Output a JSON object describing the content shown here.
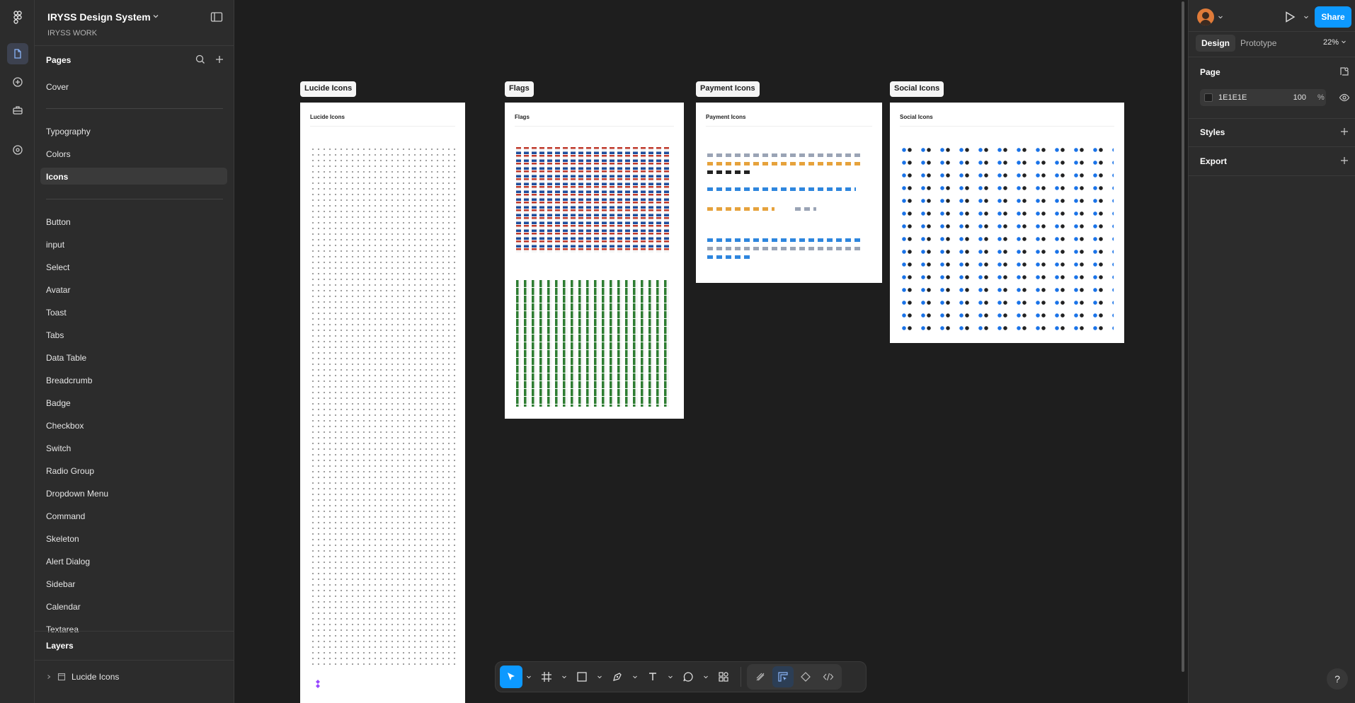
{
  "file": {
    "title": "IRYSS Design System",
    "team": "IRYSS WORK"
  },
  "pages": {
    "heading": "Pages",
    "group1": [
      "Cover"
    ],
    "group2": [
      "Typography",
      "Colors",
      "Icons"
    ],
    "group3": [
      "Button",
      "input",
      "Select",
      "Avatar",
      "Toast",
      "Tabs",
      "Data Table",
      "Breadcrumb",
      "Badge",
      "Checkbox",
      "Switch",
      "Radio Group",
      "Dropdown Menu",
      "Command",
      "Skeleton",
      "Alert Dialog",
      "Sidebar",
      "Calendar",
      "Textarea"
    ],
    "selected": "Icons"
  },
  "layers": {
    "heading": "Layers",
    "items": [
      "Lucide Icons"
    ]
  },
  "canvas": {
    "frames": [
      {
        "label": "Lucide Icons",
        "title": "Lucide Icons"
      },
      {
        "label": "Flags",
        "title": "Flags"
      },
      {
        "label": "Payment Icons",
        "title": "Payment Icons"
      },
      {
        "label": "Social Icons",
        "title": "Social Icons"
      }
    ]
  },
  "right": {
    "share": "Share",
    "tabs": [
      "Design",
      "Prototype"
    ],
    "zoom": "22%",
    "page_heading": "Page",
    "page_color": "1E1E1E",
    "page_opacity": "100",
    "page_pct": "%",
    "styles": "Styles",
    "export": "Export",
    "help": "?"
  },
  "colors": {
    "accent": "#0d99ff",
    "canvas": "#1e1e1e",
    "panel": "#2c2c2c"
  }
}
